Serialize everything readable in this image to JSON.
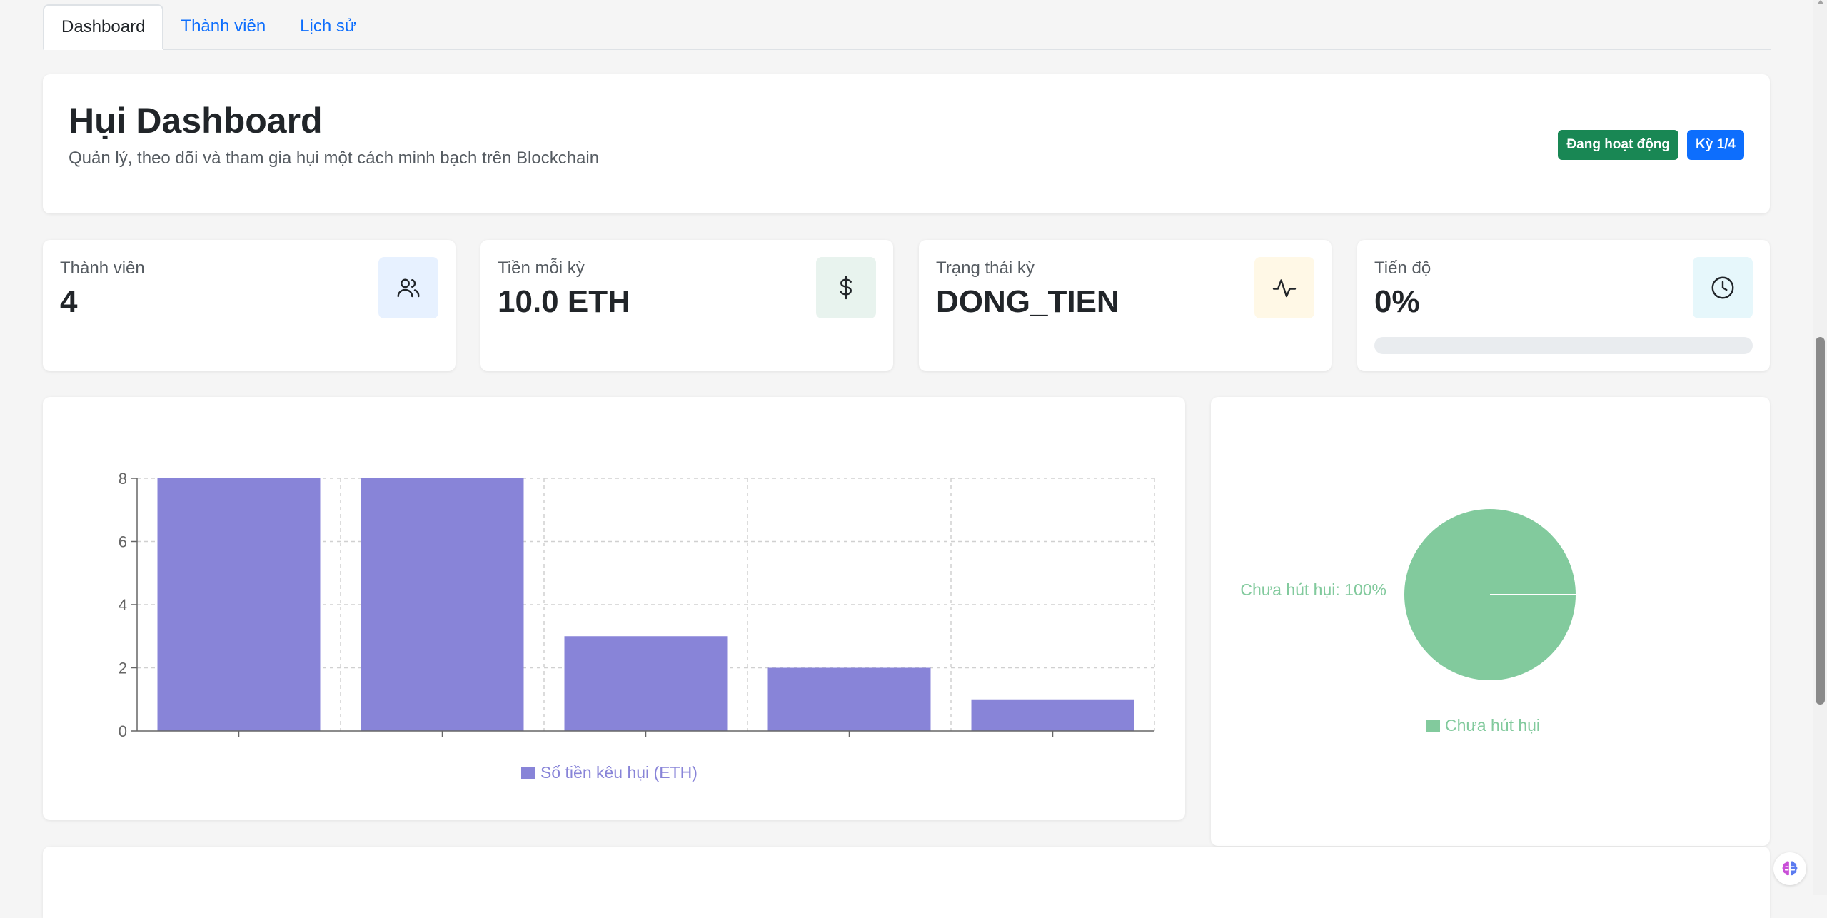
{
  "tabs": [
    {
      "label": "Dashboard",
      "active": true
    },
    {
      "label": "Thành viên",
      "active": false
    },
    {
      "label": "Lịch sử",
      "active": false
    }
  ],
  "header": {
    "title": "Hụi Dashboard",
    "subtitle": "Quản lý, theo dõi và tham gia hụi một cách minh bạch trên Blockchain",
    "status_badge": "Đang hoạt động",
    "period_badge": "Kỳ 1/4"
  },
  "stats": [
    {
      "label": "Thành viên",
      "value": "4",
      "icon": "users-icon",
      "icon_bg": "#e7f1ff"
    },
    {
      "label": "Tiền mỗi kỳ",
      "value": "10.0 ETH",
      "icon": "dollar-icon",
      "icon_bg": "#e8f3ee"
    },
    {
      "label": "Trạng thái kỳ",
      "value": "DONG_TIEN",
      "icon": "activity-icon",
      "icon_bg": "#fff8e6"
    },
    {
      "label": "Tiến độ",
      "value": "0%",
      "icon": "clock-icon",
      "icon_bg": "#e6f7fb",
      "progress": 0
    }
  ],
  "colors": {
    "primary": "#0d6efd",
    "success": "#198754",
    "bar": "#8884d8",
    "pie": "#82ca9d"
  },
  "chart_data": [
    {
      "type": "bar",
      "categories": [
        "",
        "",
        "",
        "",
        ""
      ],
      "series": [
        {
          "name": "Số tiền kêu hụi (ETH)",
          "values": [
            8,
            8,
            3,
            2,
            1
          ]
        }
      ],
      "ylim": [
        0,
        8
      ],
      "yticks": [
        0,
        2,
        4,
        6,
        8
      ],
      "grid": true,
      "legend": "bottom"
    },
    {
      "type": "pie",
      "slices": [
        {
          "name": "Chưa hút hụi",
          "value": 100,
          "label": "Chưa hút hụi: 100%"
        }
      ],
      "legend": "bottom"
    }
  ]
}
